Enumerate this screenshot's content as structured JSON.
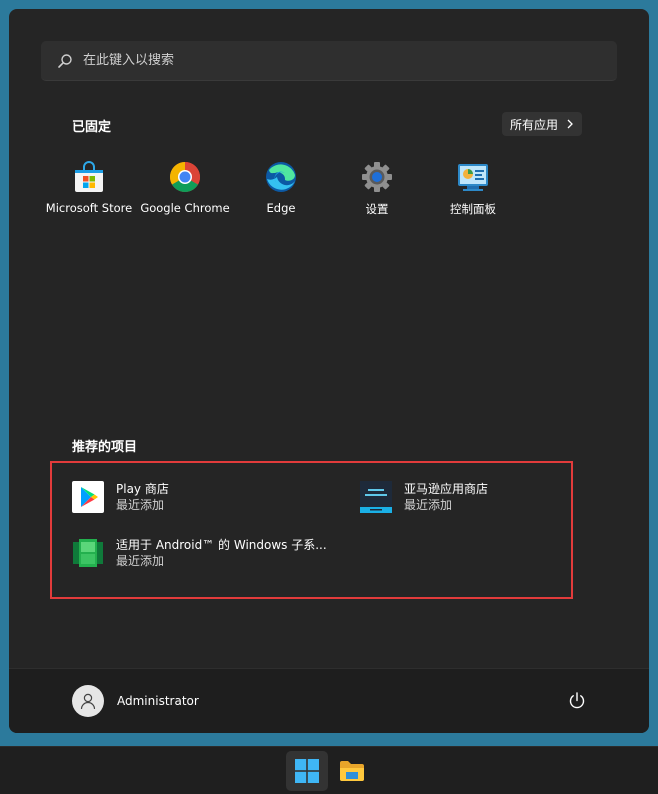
{
  "search": {
    "placeholder": "在此键入以搜索"
  },
  "pinned": {
    "title": "已固定",
    "all_apps_label": "所有应用",
    "apps": [
      {
        "label": "Microsoft Store",
        "icon": "microsoft-store-icon"
      },
      {
        "label": "Google Chrome",
        "icon": "google-chrome-icon"
      },
      {
        "label": "Edge",
        "icon": "edge-icon"
      },
      {
        "label": "设置",
        "icon": "settings-gear-icon"
      },
      {
        "label": "控制面板",
        "icon": "control-panel-icon"
      }
    ]
  },
  "recommended": {
    "title": "推荐的项目",
    "items": [
      {
        "name": "Play 商店",
        "subtitle": "最近添加",
        "icon": "play-store-icon"
      },
      {
        "name": "亚马逊应用商店",
        "subtitle": "最近添加",
        "icon": "amazon-appstore-icon"
      },
      {
        "name": "适用于 Android™ 的 Windows 子系...",
        "subtitle": "最近添加",
        "icon": "wsa-icon"
      }
    ]
  },
  "user": {
    "name": "Administrator"
  },
  "colors": {
    "desktop": "#2c7a9c",
    "menu_bg": "#252525",
    "highlight_border": "#e23b3b",
    "taskbar": "#1f1f1f"
  }
}
